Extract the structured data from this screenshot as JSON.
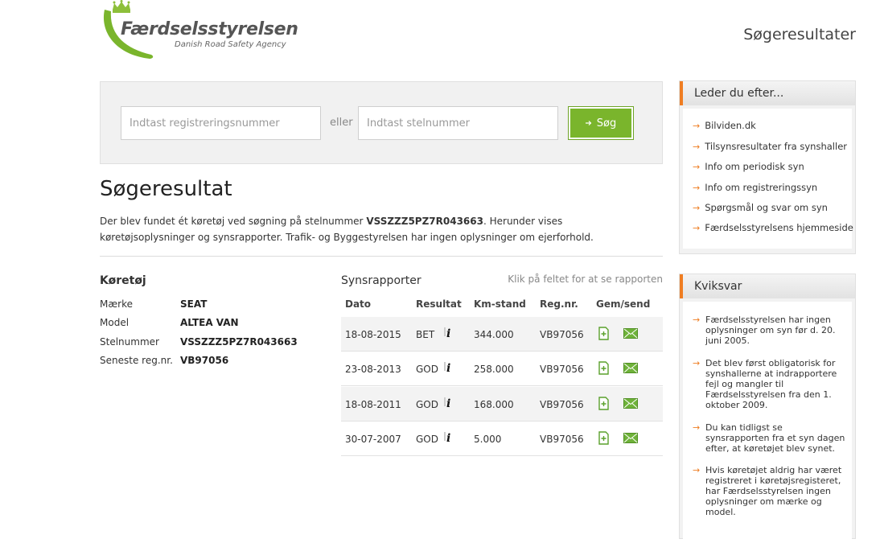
{
  "logo": {
    "name": "Færdselsstyrelsen",
    "tagline": "Danish Road Safety Agency",
    "green": "#7ab52c",
    "crown": "#8dbf3a"
  },
  "page_heading": "Søgeresultater",
  "search": {
    "reg_placeholder": "Indtast registreringsnummer",
    "or_label": "eller",
    "vin_placeholder": "Indtast stelnummer",
    "button_label": "Søg",
    "button_icon": "arrow-right-icon"
  },
  "result": {
    "title": "Søgeresultat",
    "desc_before": "Der blev fundet ét køretøj ved søgning på stelnummer ",
    "desc_vin": "VSSZZZ5PZ7R043663",
    "desc_after": ". Herunder vises køretøjsoplysninger og synsrapporter. Trafik- og Byggestyrelsen har ingen oplysninger om ejerforhold."
  },
  "vehicle": {
    "title": "Køretøj",
    "fields": [
      {
        "label": "Mærke",
        "value": "SEAT"
      },
      {
        "label": "Model",
        "value": "ALTEA VAN"
      },
      {
        "label": "Stelnummer",
        "value": "VSSZZZ5PZ7R043663"
      },
      {
        "label": "Seneste reg.nr.",
        "value": "VB97056"
      }
    ]
  },
  "reports": {
    "title": "Synsrapporter",
    "hint": "Klik på feltet for at se rapporten",
    "columns": [
      "Dato",
      "Resultat",
      "Km-stand",
      "Reg.nr.",
      "Gem/send"
    ],
    "rows": [
      {
        "date": "18-08-2015",
        "result": "BET",
        "km": "344.000",
        "reg": "VB97056"
      },
      {
        "date": "23-08-2013",
        "result": "GOD",
        "km": "258.000",
        "reg": "VB97056"
      },
      {
        "date": "18-08-2011",
        "result": "GOD",
        "km": "168.000",
        "reg": "VB97056"
      },
      {
        "date": "30-07-2007",
        "result": "GOD",
        "km": "5.000",
        "reg": "VB97056"
      }
    ],
    "icons": {
      "info": "info-icon",
      "save": "save-pdf-icon",
      "send": "email-icon"
    }
  },
  "sidebar": {
    "links_title": "Leder du efter...",
    "links": [
      "Bilviden.dk",
      "Tilsynsresultater fra synshaller",
      "Info om periodisk syn",
      "Info om registreringssyn",
      "Spørgsmål og svar om syn",
      "Færdselsstyrelsens hjemmeside"
    ],
    "faq_title": "Kviksvar",
    "faq": [
      "Færdselsstyrelsen har ingen oplysninger om syn før d. 20. juni 2005.",
      "Det blev først obligatorisk for synshallerne at indrapportere fejl og mangler til Færdselsstyrelsen fra den 1. oktober 2009.",
      "Du kan tidligst se synsrapporten fra et syn dagen efter, at køretøjet blev synet.",
      "Hvis køretøjet aldrig har været registreret i køretøjsregisteret, har Færdselsstyrelsen ingen oplysninger om mærke og model."
    ],
    "accent": "#ef7d22"
  }
}
